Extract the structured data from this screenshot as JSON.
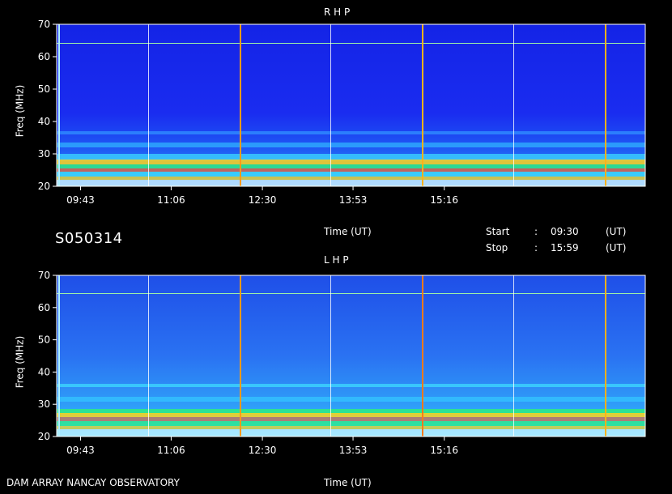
{
  "header": {
    "observation_id": "S050314",
    "time_axis_label": "Time (UT)",
    "start_label": "Start",
    "stop_label": "Stop",
    "start_time": "09:30",
    "stop_time": "15:59",
    "ut_label": "(UT)",
    "separator": ":"
  },
  "footer": {
    "instrument": "DAM ARRAY  NANCAY OBSERVATORY",
    "time_axis_label": "Time (UT)"
  },
  "chart_data": [
    {
      "type": "heatmap",
      "title": "R H P",
      "ylabel": "Freq (MHz)",
      "xlabel": "Time (UT)",
      "yticks": [
        20,
        30,
        40,
        50,
        60,
        70
      ],
      "ylim": [
        20,
        70
      ],
      "xticks": [
        "09:43",
        "11:06",
        "12:30",
        "13:53",
        "15:16"
      ],
      "xlim": [
        "09:30",
        "15:59"
      ],
      "colors": {
        "background": "#1b2ef0",
        "band": "#ffd21a",
        "line_white": "#ffffff",
        "line_orange": "#ff8a00"
      }
    },
    {
      "type": "heatmap",
      "title": "L H P",
      "ylabel": "Freq (MHz)",
      "xlabel": "Time (UT)",
      "yticks": [
        20,
        30,
        40,
        50,
        60,
        70
      ],
      "ylim": [
        20,
        70
      ],
      "xticks": [
        "09:43",
        "11:06",
        "12:30",
        "13:53",
        "15:16"
      ],
      "xlim": [
        "09:30",
        "15:59"
      ],
      "colors": {
        "background": "#2a6df2",
        "band": "#ffd21a",
        "line_white": "#ffffff",
        "line_orange": "#ff8a00"
      }
    }
  ]
}
